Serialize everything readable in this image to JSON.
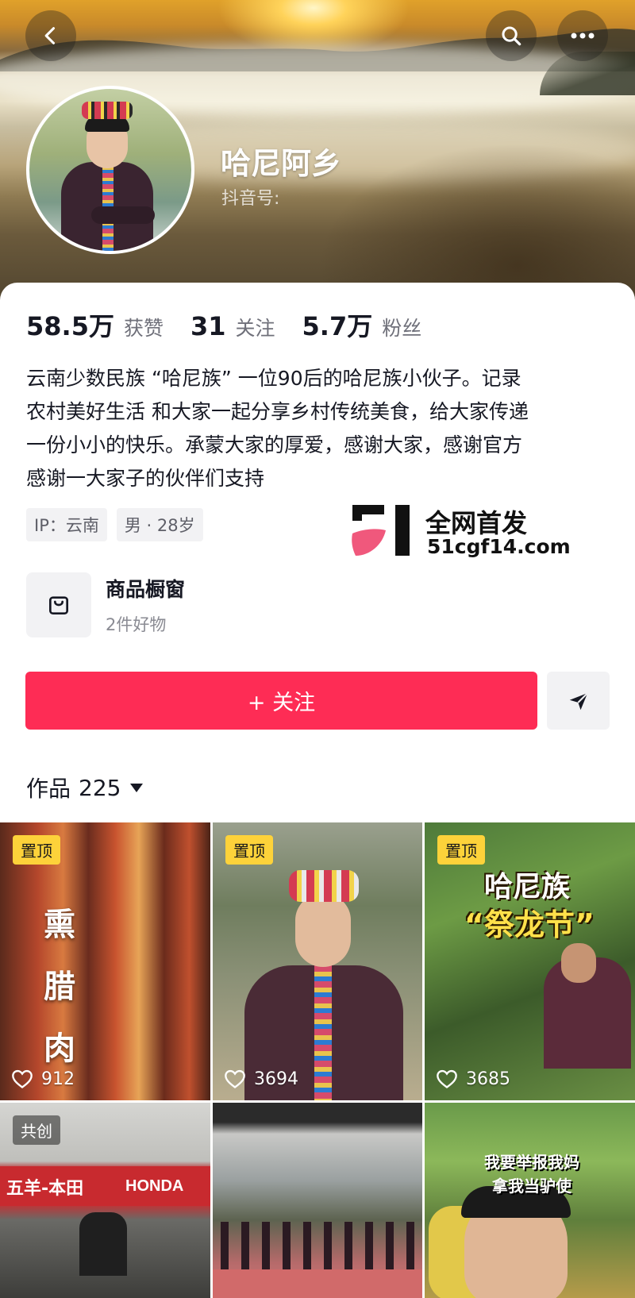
{
  "header": {
    "username": "哈尼阿乡",
    "douyin_id_label": "抖音号:"
  },
  "stats": [
    {
      "value": "58.5万",
      "label": "获赞"
    },
    {
      "value": "31",
      "label": "关注"
    },
    {
      "value": "5.7万",
      "label": "粉丝"
    }
  ],
  "bio": "云南少数民族 “哈尼族” 一位90后的哈尼族小伙子。记录\n农村美好生活 和大家一起分享乡村传统美食，给大家传递\n一份小小的快乐。承蒙大家的厚爱，感谢大家，感谢官方\n感谢一大家子的伙伴们支持",
  "tags": [
    "IP：云南",
    "男 · 28岁"
  ],
  "watermark": {
    "line1": "全网首发",
    "line2": "51cgf14.com"
  },
  "shop": {
    "title": "商品橱窗",
    "subtitle": "2件好物"
  },
  "actions": {
    "follow_label": "+ 关注"
  },
  "works": {
    "label": "作品",
    "count": "225"
  },
  "videos": [
    {
      "badge": "置顶",
      "likes": "912",
      "overlay": "熏腊肉"
    },
    {
      "badge": "置顶",
      "likes": "3694"
    },
    {
      "badge": "置顶",
      "likes": "3685",
      "overlay_line1": "哈尼族",
      "overlay_line2": "“祭龙节”"
    },
    {
      "badge": "共创",
      "sign_text": "五羊-本田",
      "sign_brand": "HONDA"
    },
    {},
    {
      "overlay_line1": "我要举报我妈",
      "overlay_line2": "拿我当驴使"
    }
  ],
  "colors": {
    "accent": "#fe2c55",
    "pin_badge": "#fdd23a",
    "text_primary": "#161823",
    "text_secondary": "#6f707a"
  },
  "icons": {
    "back": "chevron-left-icon",
    "search": "search-icon",
    "more": "more-icon",
    "shop": "shopping-bag-icon",
    "share": "send-icon",
    "likes": "heart-icon"
  }
}
